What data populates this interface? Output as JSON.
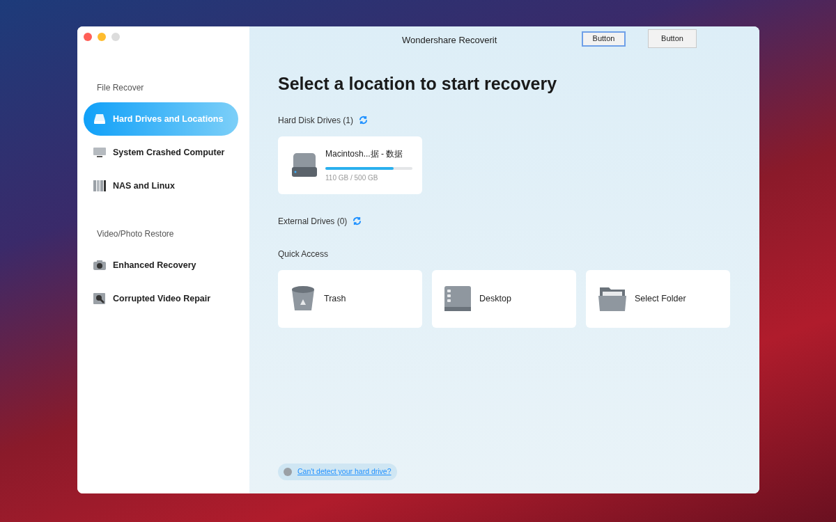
{
  "window": {
    "title": "Wondershare Recoverit",
    "buttons": [
      {
        "label": "Button",
        "focused": true
      },
      {
        "label": "Button",
        "focused": false
      }
    ]
  },
  "sidebar": {
    "sections": [
      {
        "title": "File Recover",
        "items": [
          {
            "label": "Hard Drives and Locations",
            "kind": "drive",
            "selected": true
          },
          {
            "label": "System Crashed Computer",
            "kind": "monitor",
            "selected": false
          },
          {
            "label": "NAS and Linux",
            "kind": "nas",
            "selected": false
          }
        ]
      },
      {
        "title": "Video/Photo Restore",
        "items": [
          {
            "label": "Enhanced Recovery",
            "kind": "camera",
            "selected": false
          },
          {
            "label": "Corrupted Video Repair",
            "kind": "repair",
            "selected": false
          }
        ]
      }
    ]
  },
  "main": {
    "heading": "Select a location to start recovery",
    "hard_disk_drives": {
      "title": "Hard Disk Drives (1)",
      "drives": [
        {
          "name": "Macintosh...据 - 数据",
          "level": 0.78,
          "usage": "110 GB / 500 GB"
        }
      ]
    },
    "external_drives": {
      "title": "External Drives (0)"
    },
    "quick_access": {
      "title": "Quick Access",
      "items": [
        {
          "label": "Trash",
          "kind": "trash"
        },
        {
          "label": "Desktop",
          "kind": "desktop"
        },
        {
          "label": "Select Folder",
          "kind": "folder"
        }
      ]
    },
    "help_link": "Can't detect your hard drive?"
  }
}
